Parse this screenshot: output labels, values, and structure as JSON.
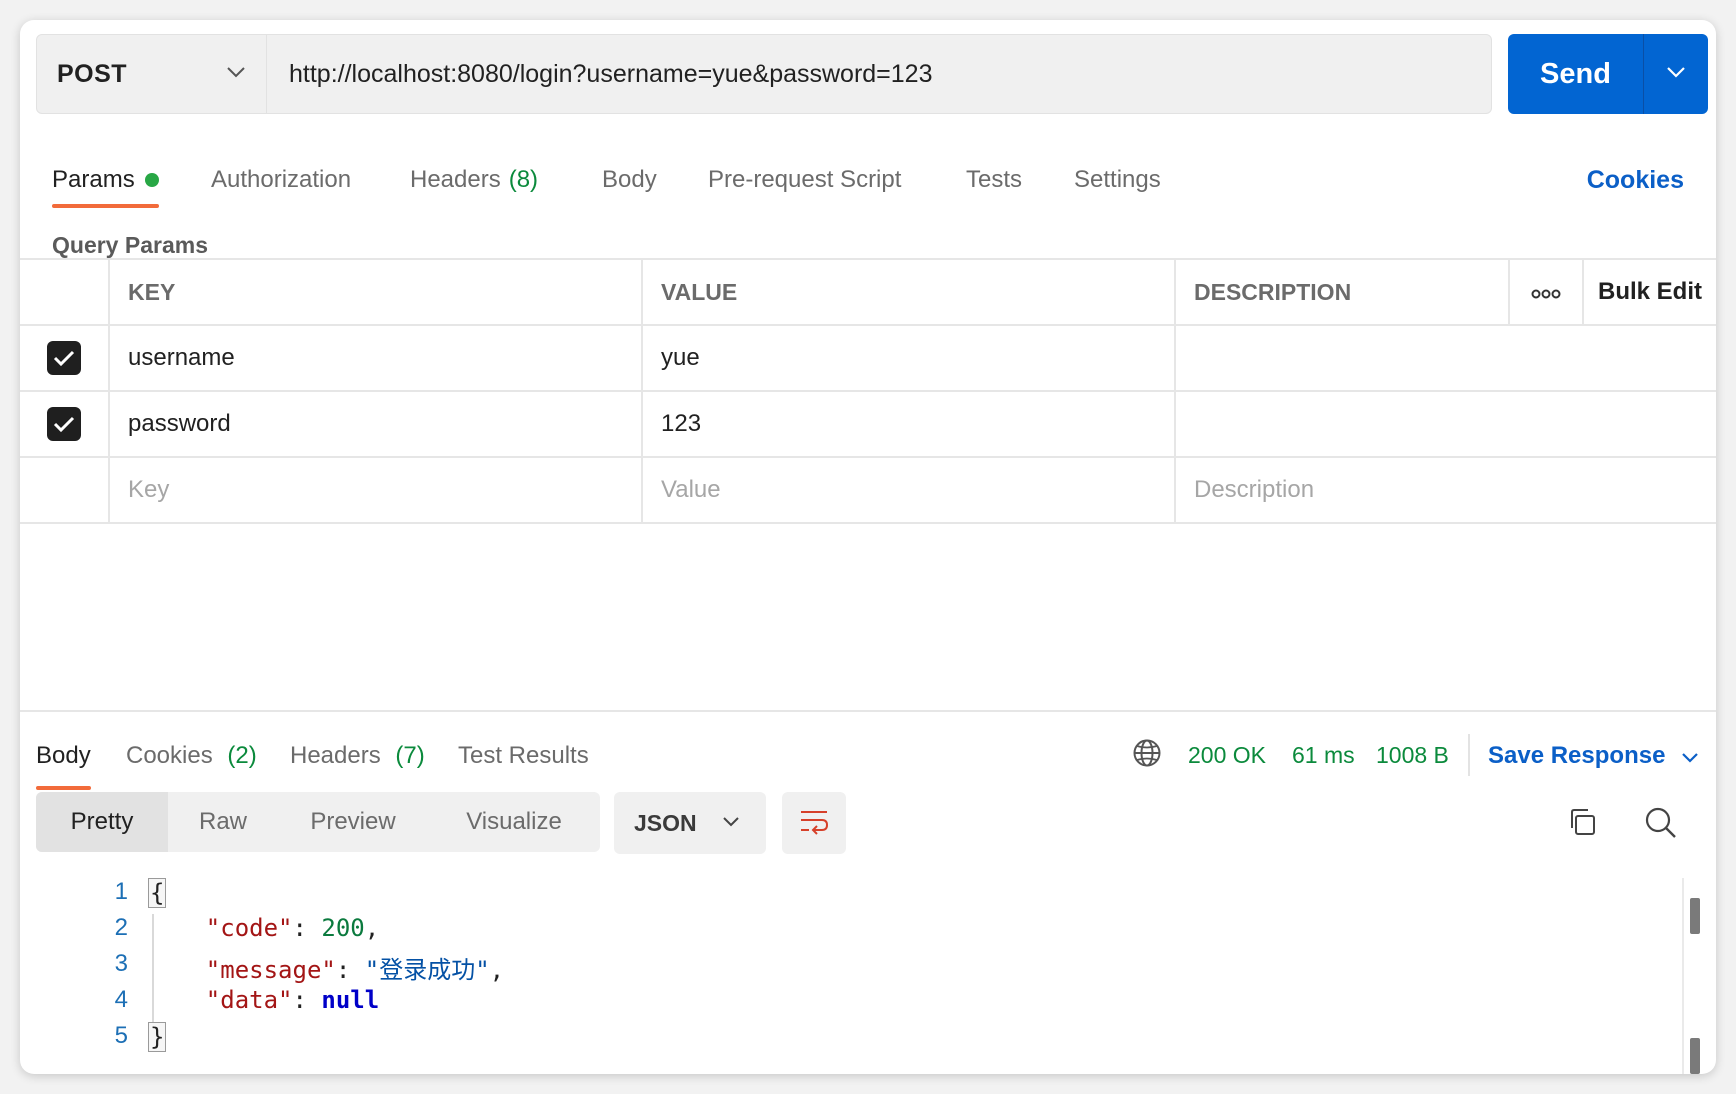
{
  "request": {
    "method": "POST",
    "url": "http://localhost:8080/login?username=yue&password=123",
    "send_label": "Send"
  },
  "request_tabs": [
    {
      "label": "Params",
      "active": true,
      "indicator": "green-dot"
    },
    {
      "label": "Authorization"
    },
    {
      "label": "Headers",
      "count": "(8)"
    },
    {
      "label": "Body"
    },
    {
      "label": "Pre-request Script"
    },
    {
      "label": "Tests"
    },
    {
      "label": "Settings"
    }
  ],
  "cookies_link": "Cookies",
  "query_params": {
    "title": "Query Params",
    "headers": {
      "key": "KEY",
      "value": "VALUE",
      "description": "DESCRIPTION",
      "more_icon": "more-dots-icon",
      "bulk_edit": "Bulk Edit"
    },
    "rows": [
      {
        "checked": true,
        "key": "username",
        "value": "yue",
        "description": ""
      },
      {
        "checked": true,
        "key": "password",
        "value": "123",
        "description": ""
      }
    ],
    "placeholders": {
      "key": "Key",
      "value": "Value",
      "description": "Description"
    }
  },
  "response_tabs": [
    {
      "label": "Body",
      "active": true
    },
    {
      "label": "Cookies",
      "count": "(2)"
    },
    {
      "label": "Headers",
      "count": "(7)"
    },
    {
      "label": "Test Results"
    }
  ],
  "response_meta": {
    "status": "200 OK",
    "time": "61 ms",
    "size": "1008 B",
    "save_label": "Save Response"
  },
  "format_tabs": [
    {
      "label": "Pretty",
      "active": true
    },
    {
      "label": "Raw"
    },
    {
      "label": "Preview"
    },
    {
      "label": "Visualize"
    }
  ],
  "language": "JSON",
  "body_lines": [
    {
      "num": "1",
      "open": "{"
    },
    {
      "num": "2",
      "key": "\"code\"",
      "colon": ": ",
      "value": "200",
      "comma": ","
    },
    {
      "num": "3",
      "key": "\"message\"",
      "colon": ": ",
      "value": "\"登录成功\"",
      "comma": ","
    },
    {
      "num": "4",
      "key": "\"data\"",
      "colon": ": ",
      "value": "null",
      "comma": ""
    },
    {
      "num": "5",
      "close": "}"
    }
  ],
  "colors": {
    "accent_orange": "#f26b3a",
    "send_blue": "#0265d2",
    "link_blue": "#0b5fc7",
    "status_green": "#0b8a3c"
  }
}
